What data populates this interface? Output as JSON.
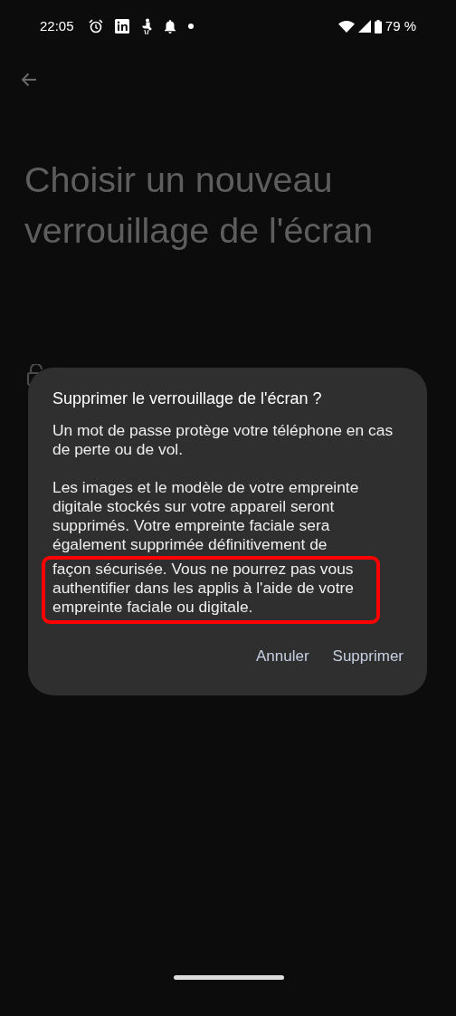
{
  "status_bar": {
    "time": "22:05",
    "battery": "79 %"
  },
  "title": "Choisir un nouveau verrouillage de l'écran",
  "dialog": {
    "title": "Supprimer le verrouillage de l'écran ?",
    "paragraphs": [
      {
        "text": "Un mot de passe protège votre téléphone en cas de perte ou de vol."
      },
      {
        "text": "Les images et le modèle de votre empreinte digitale stockés sur votre appareil seront supprimés. Votre empreinte faciale sera également supprimée définitivement de",
        "highlighted": "façon sécurisée. Vous ne pourrez pas vous authentifier dans les applis à l'aide de votre empreinte faciale ou digitale."
      }
    ],
    "buttons": [
      "Annuler",
      "Supprimer"
    ]
  }
}
